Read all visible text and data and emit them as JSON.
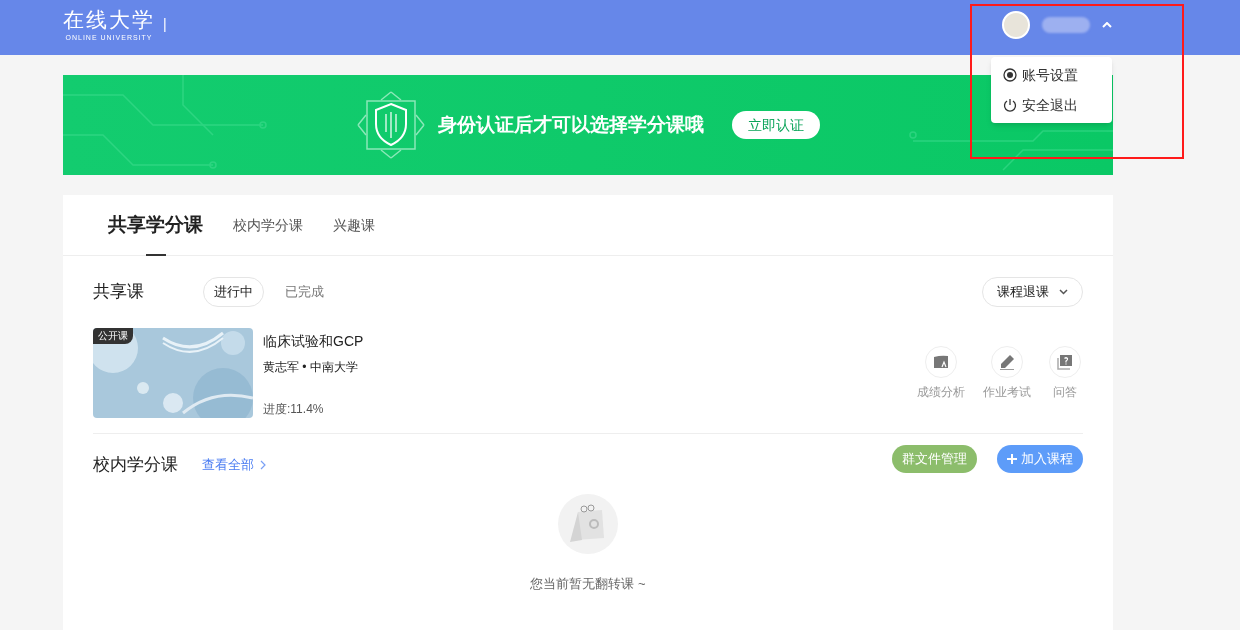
{
  "header": {
    "logo": "在线大学",
    "logo_subtitle": "ONLINE UNIVERSITY",
    "divider": "|"
  },
  "user_menu": {
    "expanded": true,
    "items": [
      {
        "label": "账号设置",
        "kind": "settings"
      },
      {
        "label": "安全退出",
        "kind": "logout"
      }
    ]
  },
  "banner": {
    "message": "身份认证后才可以选择学分课哦",
    "button": "立即认证"
  },
  "tabs": [
    {
      "label": "共享学分课",
      "selected": true
    },
    {
      "label": "校内学分课",
      "selected": false
    },
    {
      "label": "兴趣课",
      "selected": false
    }
  ],
  "shared_section": {
    "title": "共享课",
    "filters": [
      {
        "label": "进行中",
        "selected": true
      },
      {
        "label": "已完成",
        "selected": false
      }
    ],
    "dropdown": "课程退课"
  },
  "courses": [
    {
      "badge": "公开课",
      "title": "临床试验和GCP",
      "teacher": "黄志军 • 中南大学",
      "progress": "进度:11.4%",
      "actions": [
        {
          "label": "成绩分析",
          "kind": "grades"
        },
        {
          "label": "作业考试",
          "kind": "homework"
        },
        {
          "label": "问答",
          "kind": "qa"
        }
      ]
    }
  ],
  "campus_section": {
    "title": "校内学分课",
    "view_all": "查看全部",
    "buttons": [
      {
        "label": "群文件管理",
        "kind": "files"
      },
      {
        "label": "加入课程",
        "kind": "add"
      }
    ],
    "empty_message": "您当前暂无翻转课 ~"
  }
}
